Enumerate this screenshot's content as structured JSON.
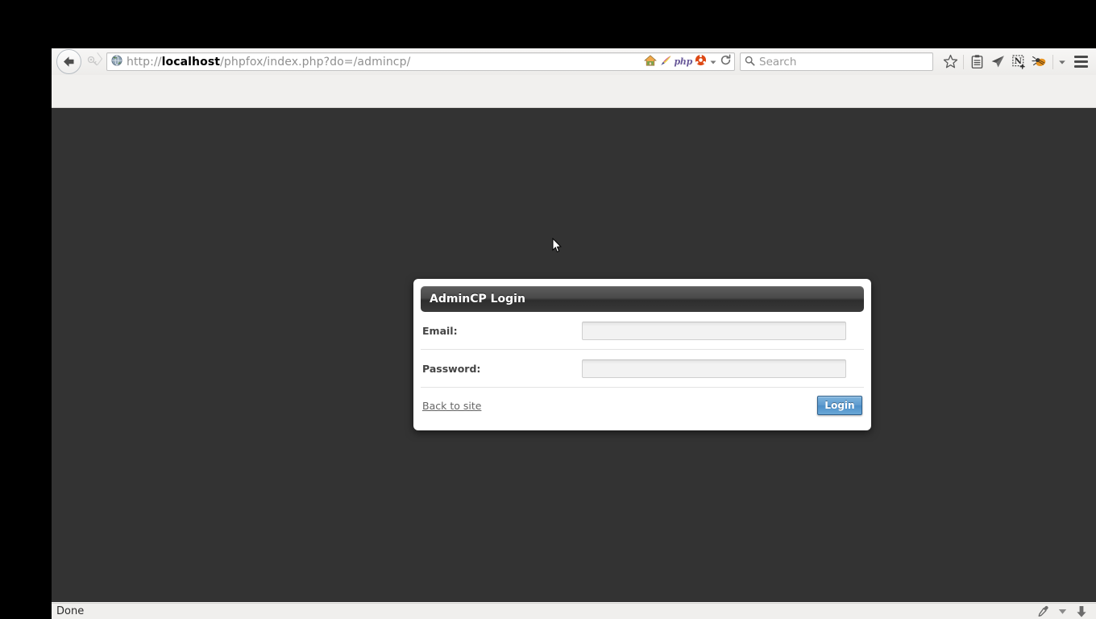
{
  "browser": {
    "nav": {
      "back_label": "Back",
      "forward_label": "Forward",
      "url_prefix": "http://",
      "url_host": "localhost",
      "url_path": "/phpfox/index.php?do=/admincp/",
      "url_full": "http://localhost/phpfox/index.php?do=/admincp/",
      "php_badge": "php",
      "reload_label": "Reload",
      "dropdown_label": "Show history"
    },
    "search": {
      "placeholder": "Search",
      "value": ""
    },
    "toolbar_buttons": [
      {
        "name": "bookmark-star-icon",
        "label": "Bookmark this page"
      },
      {
        "name": "reading-list-icon",
        "label": "Reading list"
      },
      {
        "name": "send-page-icon",
        "label": "Send page"
      },
      {
        "name": "evernote-clipper-icon",
        "label": "Evernote Web Clipper"
      },
      {
        "name": "firebug-icon",
        "label": "Firebug"
      },
      {
        "name": "overflow-caret-icon",
        "label": "More tools"
      },
      {
        "name": "hamburger-menu-icon",
        "label": "Open menu"
      }
    ],
    "statusbar": {
      "text": "Done",
      "icons": [
        {
          "name": "eyedropper-icon",
          "label": "Color picker"
        },
        {
          "name": "caret-down-icon",
          "label": "More"
        },
        {
          "name": "download-arrow-icon",
          "label": "Downloads"
        }
      ]
    }
  },
  "page": {
    "background_color": "#333333",
    "dialog": {
      "title": "AdminCP Login",
      "fields": [
        {
          "label": "Email:",
          "value": "",
          "placeholder": "",
          "type": "text",
          "name": "email-field"
        },
        {
          "label": "Password:",
          "value": "",
          "placeholder": "",
          "type": "password",
          "name": "password-field"
        }
      ],
      "back_link": "Back to site",
      "submit_label": "Login",
      "accent_color": "#5d9ace",
      "header_color": "#3a3a3a"
    }
  }
}
